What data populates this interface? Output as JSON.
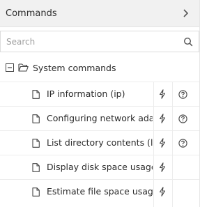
{
  "header": {
    "title": "Commands",
    "expand_icon": "chevron-right-icon"
  },
  "search": {
    "placeholder": "Search",
    "value": "",
    "icon": "search-icon"
  },
  "group": {
    "label": "System commands",
    "collapse_icon": "minus-box-icon",
    "folder_icon": "folder-open-icon"
  },
  "commands": [
    {
      "label": "IP information (ip)",
      "has_help": true
    },
    {
      "label": "Configuring network adapters",
      "has_help": true
    },
    {
      "label": "List directory contents (ls)",
      "has_help": true
    },
    {
      "label": "Display disk space usage",
      "has_help": false
    },
    {
      "label": "Estimate file space usage",
      "has_help": false
    }
  ],
  "colors": {
    "header_bg": "#f1f1f1",
    "border": "#e4e4e4",
    "text": "#2b2b2b"
  }
}
